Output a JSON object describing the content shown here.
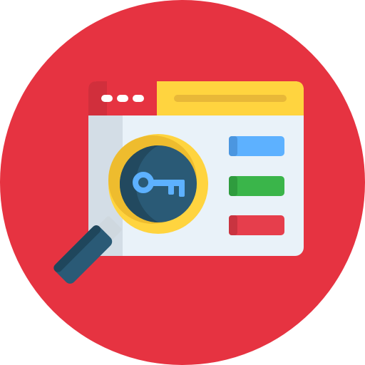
{
  "icon": {
    "name": "keyword-search-icon",
    "colors": {
      "background_circle": "#e63341",
      "window_body": "#e9f2f9",
      "window_sidebar": "#d3dde6",
      "titlebar_left": "#e63341",
      "titlebar_left_shade": "#d12f3c",
      "titlebar_right": "#ffd43f",
      "titlebar_dots": "#ffffff",
      "address_bar": "#e8b838",
      "bar_blue": "#5db1ff",
      "bar_blue_shade": "#4b96e0",
      "bar_green": "#3ab54a",
      "bar_green_shade": "#2f9c3e",
      "bar_red": "#e63e4c",
      "bar_red_shade": "#c93440",
      "magnifier_ring": "#ffd43f",
      "magnifier_ring_shade": "#eebc2e",
      "magnifier_glass": "#2a5a76",
      "magnifier_glass_shade": "#22495f",
      "magnifier_neck": "#cfd8df",
      "magnifier_handle": "#2a5a76",
      "magnifier_handle_shade": "#1f465c",
      "key": "#5db1ff"
    },
    "content_bars": [
      "bar-blue",
      "bar-green",
      "bar-red"
    ]
  }
}
